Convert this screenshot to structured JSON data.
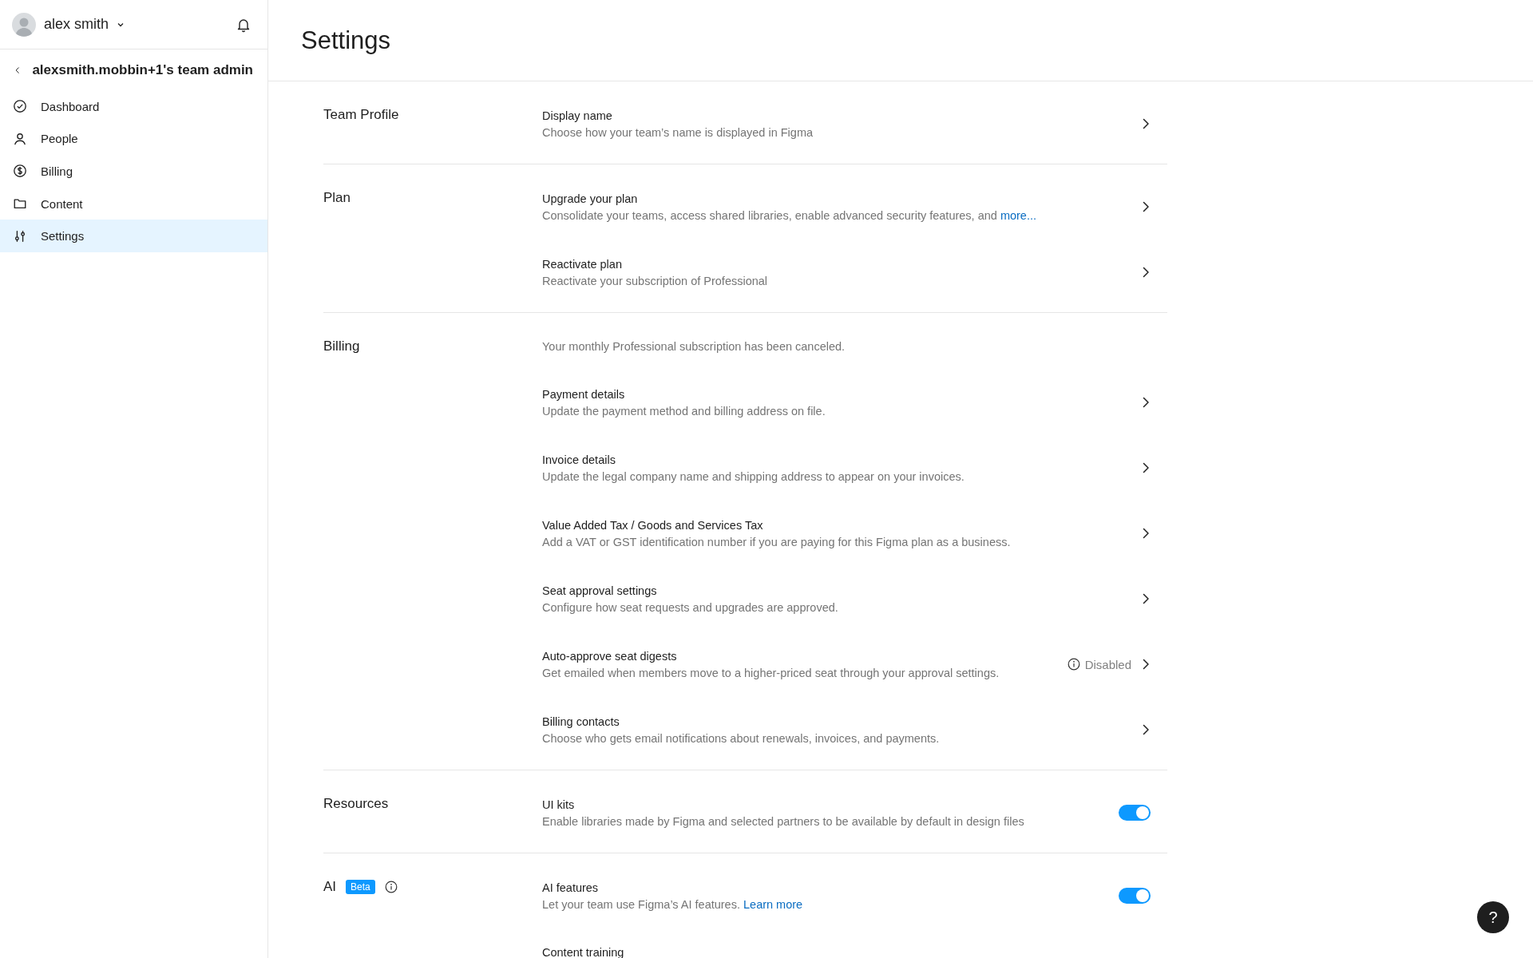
{
  "user": {
    "name": "alex smith"
  },
  "team": {
    "title": "alexsmith.mobbin+1's team admin"
  },
  "nav": [
    {
      "label": "Dashboard",
      "selected": false
    },
    {
      "label": "People",
      "selected": false
    },
    {
      "label": "Billing",
      "selected": false
    },
    {
      "label": "Content",
      "selected": false
    },
    {
      "label": "Settings",
      "selected": true
    }
  ],
  "page_title": "Settings",
  "sections": [
    {
      "title": "Team Profile",
      "rows": [
        {
          "kind": "link",
          "title": "Display name",
          "description": "Choose how your team’s name is displayed in Figma"
        }
      ]
    },
    {
      "title": "Plan",
      "rows": [
        {
          "kind": "link",
          "title": "Upgrade your plan",
          "description": "Consolidate your teams, access shared libraries, enable advanced security features, and",
          "link": "more..."
        },
        {
          "kind": "link",
          "title": "Reactivate plan",
          "description": "Reactivate your subscription of Professional"
        }
      ]
    },
    {
      "title": "Billing",
      "rows": [
        {
          "kind": "note",
          "description": "Your monthly Professional subscription has been canceled."
        },
        {
          "kind": "link",
          "title": "Payment details",
          "description": "Update the payment method and billing address on file."
        },
        {
          "kind": "link",
          "title": "Invoice details",
          "description": "Update the legal company name and shipping address to appear on your invoices."
        },
        {
          "kind": "link",
          "title": "Value Added Tax / Goods and Services Tax",
          "description": "Add a VAT or GST identification number if you are paying for this Figma plan as a business."
        },
        {
          "kind": "link",
          "title": "Seat approval settings",
          "description": "Configure how seat requests and upgrades are approved."
        },
        {
          "kind": "link",
          "title": "Auto-approve seat digests",
          "description": "Get emailed when members move to a higher-priced seat through your approval settings.",
          "status": "Disabled"
        },
        {
          "kind": "link",
          "title": "Billing contacts",
          "description": "Choose who gets email notifications about renewals, invoices, and payments."
        }
      ]
    },
    {
      "title": "Resources",
      "rows": [
        {
          "kind": "toggle",
          "title": "UI kits",
          "description": "Enable libraries made by Figma and selected partners to be available by default in design files",
          "on": true
        }
      ]
    },
    {
      "title": "AI",
      "badge": "Beta",
      "info": true,
      "rows": [
        {
          "kind": "toggle",
          "title": "AI features",
          "description": "Let your team use Figma’s AI features.",
          "link": "Learn more",
          "on": true
        },
        {
          "kind": "heading",
          "title": "Content training"
        }
      ]
    }
  ],
  "help": "?"
}
